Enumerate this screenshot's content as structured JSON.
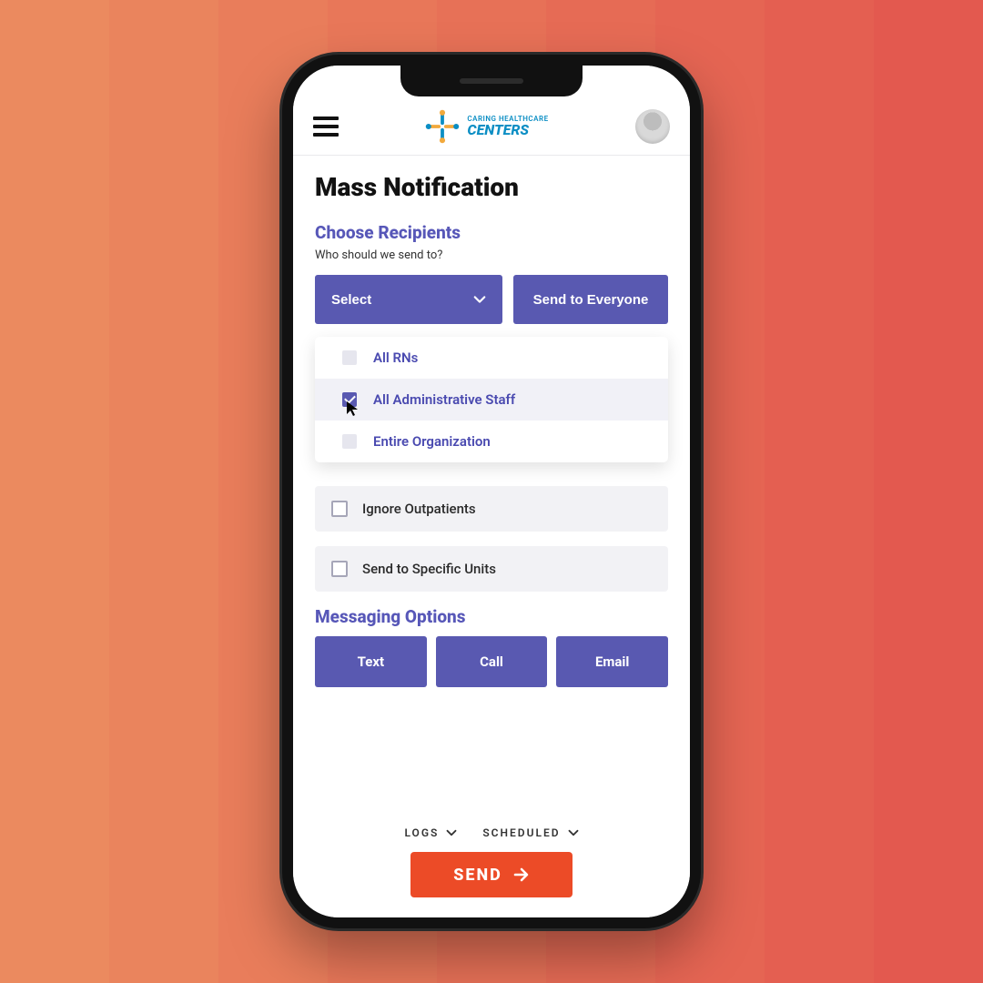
{
  "bg_stripes": [
    "#eb8a5f",
    "#ea845d",
    "#e97d5b",
    "#e87759",
    "#e77157",
    "#e66b55",
    "#e56553",
    "#e45f51",
    "#e3594f"
  ],
  "header": {
    "brand_line1": "CARING HEALTHCARE",
    "brand_line2": "CENTERS"
  },
  "page": {
    "title": "Mass Notification"
  },
  "recipients": {
    "section_title": "Choose Recipients",
    "subtitle": "Who should we send to?",
    "select_label": "Select",
    "everyone_label": "Send to Everyone",
    "options": [
      {
        "label": "All RNs",
        "selected": false
      },
      {
        "label": "All Administrative Staff",
        "selected": true
      },
      {
        "label": "Entire Organization",
        "selected": false
      }
    ],
    "ignore_outpatients": "Ignore Outpatients",
    "specific_units": "Send to Specific Units"
  },
  "messaging": {
    "section_title": "Messaging Options",
    "buttons": [
      "Text",
      "Call",
      "Email"
    ]
  },
  "footer": {
    "logs": "LOGS",
    "scheduled": "SCHEDULED",
    "send": "SEND"
  },
  "colors": {
    "primary": "#5959b1",
    "accent": "#ec4b27",
    "brand_blue": "#0b8ec4",
    "brand_gold": "#f2a93c"
  }
}
